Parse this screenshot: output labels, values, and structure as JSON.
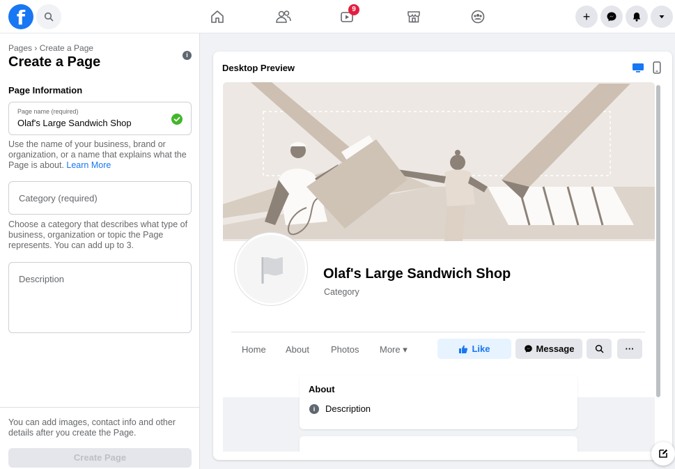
{
  "topbar": {
    "logo_letter": "f",
    "notification_count": "9",
    "create_symbol": "+",
    "icons": [
      "facebook-logo",
      "search-icon",
      "home-icon",
      "friends-icon",
      "watch-icon",
      "marketplace-icon",
      "groups-icon",
      "plus-icon",
      "messenger-icon",
      "bell-icon",
      "caret-down-icon"
    ]
  },
  "left_panel": {
    "breadcrumb": "Pages › Create a Page",
    "title": "Create a Page",
    "section": "Page Information",
    "name_field": {
      "small_label": "Page name (required)",
      "value": "Olaf's Large Sandwich Shop"
    },
    "name_help": "Use the name of your business, brand or organization, or a name that explains what the Page is about.",
    "learn_more": "Learn More",
    "category_placeholder": "Category (required)",
    "category_help": "Choose a category that describes what type of business, organization or topic the Page represents. You can add up to 3.",
    "description_placeholder": "Description",
    "footer_note": "You can add images, contact info and other details after you create the Page.",
    "create_button": "Create Page"
  },
  "preview": {
    "title": "Desktop Preview",
    "page_name": "Olaf's Large Sandwich Shop",
    "page_category": "Category",
    "tabs": [
      "Home",
      "About",
      "Photos",
      "More ▾"
    ],
    "like_label": "Like",
    "message_label": "Message",
    "more_dots": "···",
    "about_title": "About",
    "about_description": "Description"
  },
  "colors": {
    "brand_blue": "#1877f2",
    "success_green": "#42b72a",
    "notification_red": "#e41e3f",
    "cover_beige": "#ede8e3"
  }
}
